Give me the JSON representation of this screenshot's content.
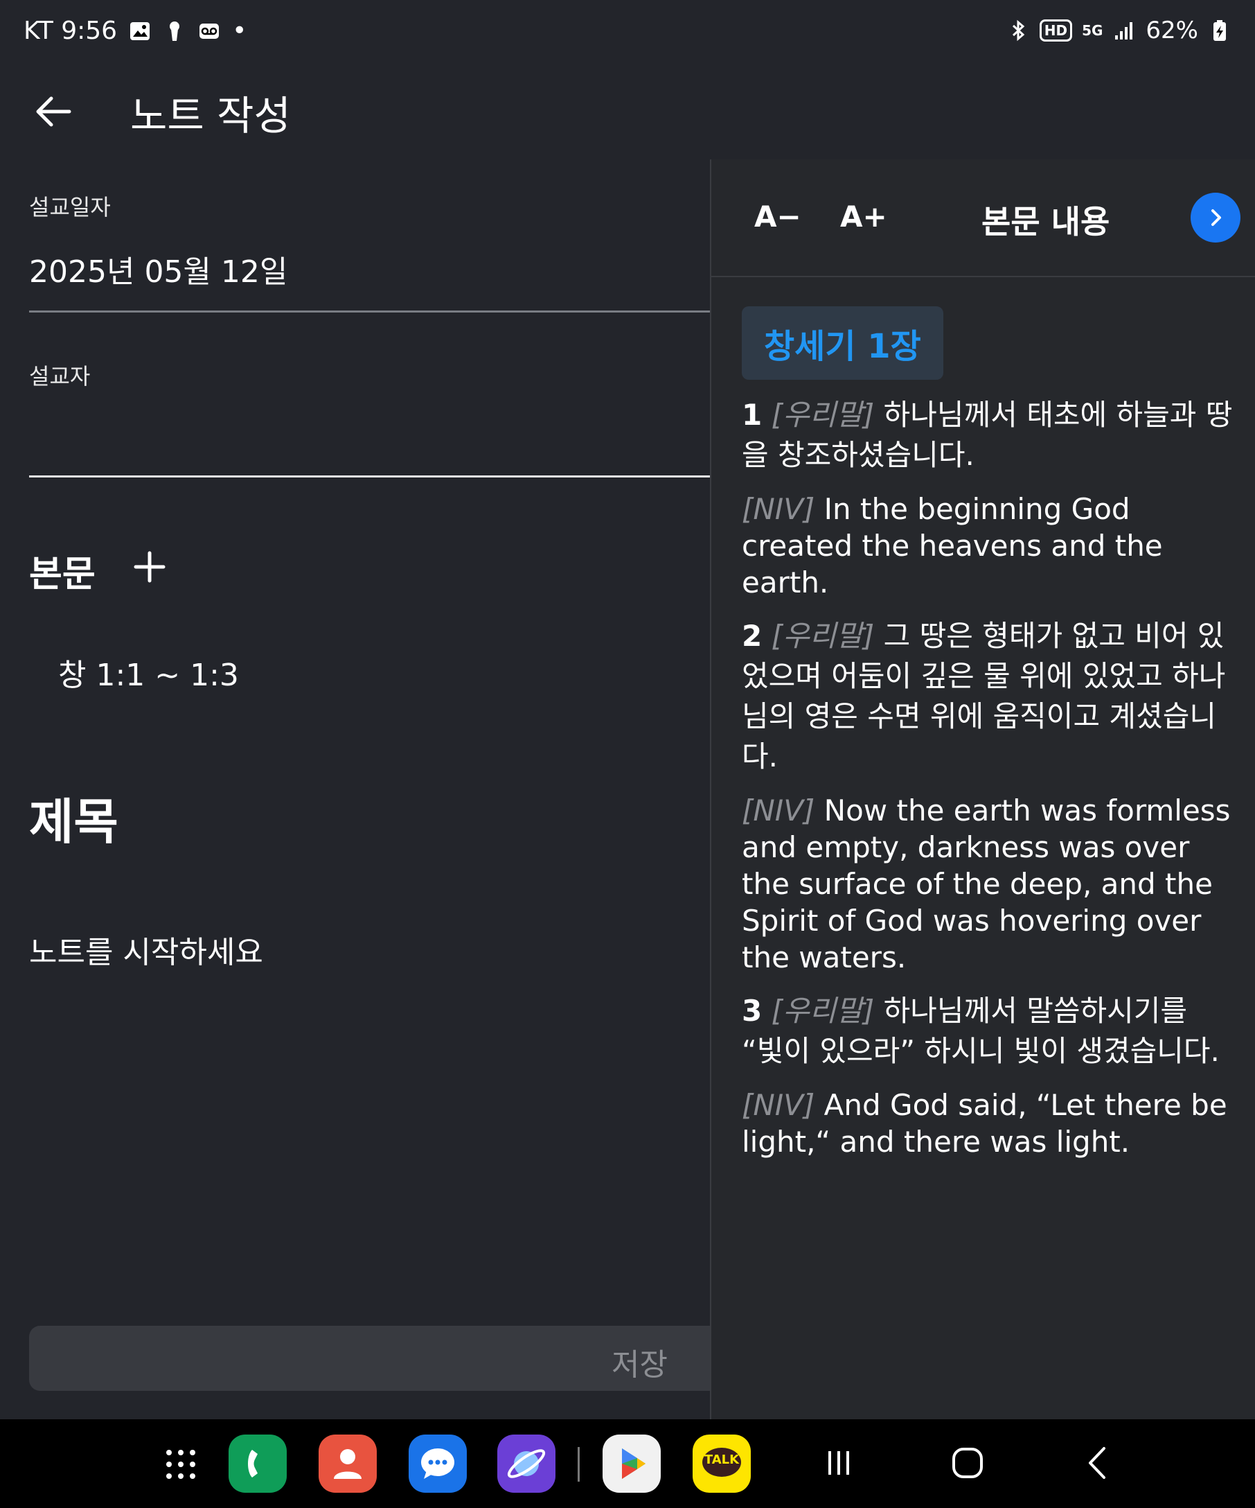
{
  "status_bar": {
    "carrier_time": "KT 9:56",
    "dot": "•",
    "battery": "62%",
    "hd_label": "HD",
    "network_label": "5G"
  },
  "app_bar": {
    "title": "노트 작성"
  },
  "form": {
    "date_label": "설교일자",
    "date_value": "2025년 05월 12일",
    "preacher_label": "설교자",
    "preacher_value": "",
    "passage_section_title": "본문",
    "passages": [
      "창 1:1 ~ 1:3"
    ],
    "title_placeholder": "제목",
    "body_placeholder": "노트를 시작하세요",
    "save_label": "저장"
  },
  "panel": {
    "font_decrease": "A−",
    "font_increase": "A+",
    "title": "본문 내용",
    "chapter": "창세기 1장",
    "verses": [
      {
        "num": "1",
        "tag": "[우리말]",
        "text": "하나님께서 태초에 하늘과 땅을 창조하셨습니다."
      },
      {
        "tag": "[NIV]",
        "text": "In the beginning God created the heavens and the earth."
      },
      {
        "num": "2",
        "tag": "[우리말]",
        "text": "그 땅은 형태가 없고 비어 있었으며 어둠이 깊은 물 위에 있었고 하나님의 영은 수면 위에 움직이고 계셨습니다."
      },
      {
        "tag": "[NIV]",
        "text": "Now the earth was formless and empty, darkness was over the surface of the deep, and the Spirit of God was hovering over the waters."
      },
      {
        "num": "3",
        "tag": "[우리말]",
        "text": "하나님께서 말씀하시기를 “빛이 있으라” 하시니 빛이 생겼습니다."
      },
      {
        "tag": "[NIV]",
        "text": "And God said, “Let there be light,“ and there was light."
      }
    ]
  },
  "nav_bar": {
    "kakao_label": "TALK"
  },
  "colors": {
    "background": "#23252b",
    "accent": "#1976f2",
    "chapter_text": "#2196f3"
  }
}
